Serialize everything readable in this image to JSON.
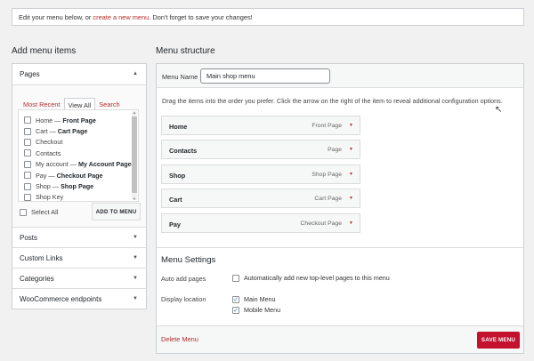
{
  "notice": {
    "before": "Edit your menu below, or ",
    "link": "create a new menu",
    "after": ". Don't forget to save your changes!"
  },
  "add_items": {
    "heading": "Add menu items",
    "pages": {
      "title": "Pages",
      "tabs": [
        "Most Recent",
        "View All",
        "Search"
      ],
      "items": [
        {
          "name": "Home",
          "state": "Front Page"
        },
        {
          "name": "Cart",
          "state": "Cart Page"
        },
        {
          "name": "Checkout",
          "state": ""
        },
        {
          "name": "Contacts",
          "state": ""
        },
        {
          "name": "My account",
          "state": "My Account Page"
        },
        {
          "name": "Pay",
          "state": "Checkout Page"
        },
        {
          "name": "Shop",
          "state": "Shop Page"
        },
        {
          "name": "Shop Key",
          "state": ""
        }
      ],
      "select_all": "Select All",
      "add_button": "ADD TO MENU"
    },
    "sections": [
      "Posts",
      "Custom Links",
      "Categories",
      "WooCommerce endpoints"
    ]
  },
  "structure": {
    "heading": "Menu structure",
    "menu_name_label": "Menu Name",
    "menu_name_value": "Main shop menu",
    "instructions": "Drag the items into the order you prefer. Click the arrow on the right of the item to reveal additional configuration options.",
    "items": [
      {
        "title": "Home",
        "type": "Front Page"
      },
      {
        "title": "Contacts",
        "type": "Page"
      },
      {
        "title": "Shop",
        "type": "Shop Page"
      },
      {
        "title": "Cart",
        "type": "Cart Page"
      },
      {
        "title": "Pay",
        "type": "Checkout Page"
      }
    ],
    "settings_title": "Menu Settings",
    "auto_add_label": "Auto add pages",
    "auto_add_option": "Automatically add new top-level pages to this menu",
    "display_location_label": "Display location",
    "locations": [
      "Main Menu",
      "Mobile Menu"
    ],
    "delete_label": "Delete Menu",
    "save_label": "SAVE MENU"
  },
  "colors": {
    "accent": "#b32d2e",
    "save_button": "#c4112e"
  }
}
